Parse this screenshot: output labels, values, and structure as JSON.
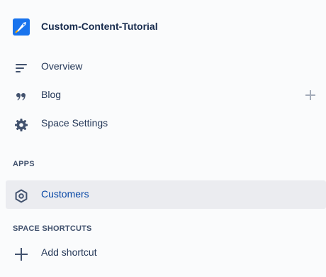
{
  "space": {
    "title": "Custom-Content-Tutorial",
    "logo_icon": "rocket-icon"
  },
  "nav": {
    "overview": {
      "label": "Overview",
      "icon": "overview-lines-icon"
    },
    "blog": {
      "label": "Blog",
      "icon": "quote-icon",
      "add_icon": "plus-icon"
    },
    "settings": {
      "label": "Space Settings",
      "icon": "gear-icon"
    }
  },
  "apps": {
    "heading": "APPS",
    "items": [
      {
        "label": "Customers",
        "icon": "hexagon-icon",
        "selected": true
      }
    ]
  },
  "shortcuts": {
    "heading": "SPACE SHORTCUTS",
    "add_label": "Add shortcut",
    "add_icon": "plus-icon"
  },
  "colors": {
    "background": "#fafbfc",
    "selected_bg": "#ebecf0",
    "selected_text": "#0747a6",
    "text": "#253858"
  }
}
